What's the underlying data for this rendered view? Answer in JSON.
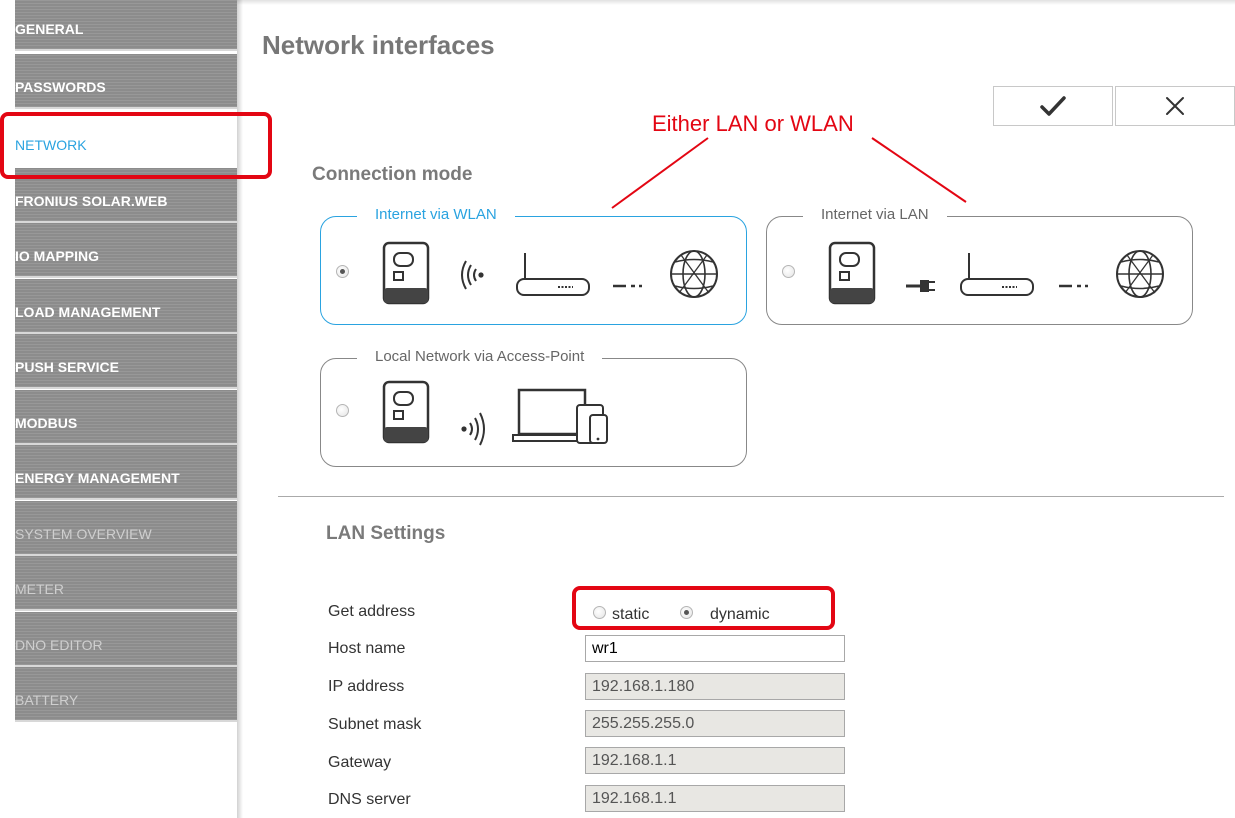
{
  "sidebar": {
    "items": [
      {
        "label": "GENERAL"
      },
      {
        "label": "PASSWORDS"
      },
      {
        "label": "NETWORK"
      },
      {
        "label": "FRONIUS SOLAR.WEB"
      },
      {
        "label": "IO MAPPING"
      },
      {
        "label": "LOAD MANAGEMENT"
      },
      {
        "label": "PUSH SERVICE"
      },
      {
        "label": "MODBUS"
      },
      {
        "label": "ENERGY MANAGEMENT"
      },
      {
        "label": "SYSTEM OVERVIEW"
      },
      {
        "label": "METER"
      },
      {
        "label": "DNO EDITOR"
      },
      {
        "label": "BATTERY"
      }
    ],
    "active": "NETWORK"
  },
  "page": {
    "title": "Network interfaces"
  },
  "toolbar": {
    "confirm_icon": "checkmark-icon",
    "cancel_icon": "close-icon"
  },
  "annotation": {
    "text": "Either LAN or WLAN"
  },
  "connection_mode": {
    "title": "Connection mode",
    "options": [
      {
        "label": "Internet via WLAN",
        "selected": true,
        "icons": [
          "inverter-icon",
          "wifi-signal-icon",
          "router-icon",
          "globe-icon"
        ]
      },
      {
        "label": "Internet via LAN",
        "selected": false,
        "icons": [
          "inverter-icon",
          "ethernet-plug-icon",
          "router-icon",
          "globe-icon"
        ]
      },
      {
        "label": "Local Network via Access-Point",
        "selected": false,
        "icons": [
          "inverter-icon",
          "wifi-broadcast-icon",
          "devices-icon"
        ]
      }
    ]
  },
  "lan_settings": {
    "title": "LAN Settings",
    "get_address": {
      "label": "Get address",
      "options": [
        "static",
        "dynamic"
      ],
      "selected": "dynamic"
    },
    "host_name": {
      "label": "Host name",
      "value": "wr1"
    },
    "ip_address": {
      "label": "IP address",
      "value": "192.168.1.180"
    },
    "subnet_mask": {
      "label": "Subnet mask",
      "value": "255.255.255.0"
    },
    "gateway": {
      "label": "Gateway",
      "value": "192.168.1.1"
    },
    "dns_server": {
      "label": "DNS server",
      "value": "192.168.1.1"
    }
  },
  "colors": {
    "accent": "#2aa3e0",
    "highlight": "#e30613",
    "sidebar_bg": "#8c8c8c"
  }
}
